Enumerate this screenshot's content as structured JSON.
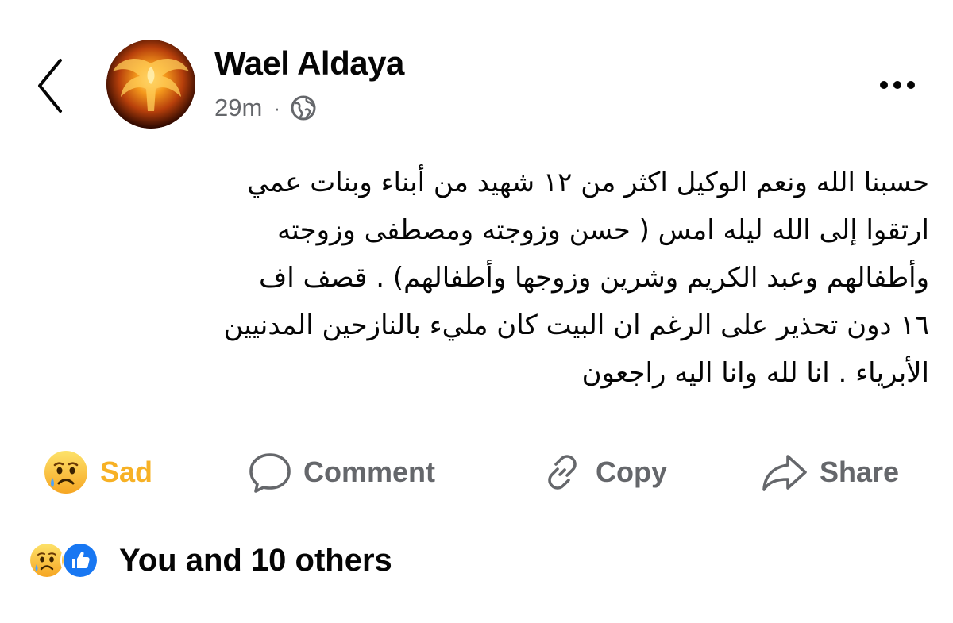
{
  "post": {
    "author": "Wael Aldaya",
    "time": "29m",
    "separator": "·",
    "privacy_icon": "globe-icon",
    "text_lines": [
      "حسبنا الله ونعم الوكيل اكثر من ١٢ شهيد من أبناء وبنات  عمي",
      "ارتقوا إلى الله  ليله امس ( حسن وزوجته ومصطفى  وزوجته",
      "وأطفالهم  وعبد الكريم وشرين وزوجها وأطفالهم) . قصف اف",
      "١٦ دون تحذير على الرغم ان البيت كان مليء بالنازحين المدنيين",
      "الأبرياء . انا لله وانا اليه راجعون"
    ]
  },
  "actions": {
    "sad_label": "Sad",
    "comment_label": "Comment",
    "copy_label": "Copy",
    "share_label": "Share"
  },
  "reactions": {
    "summary": "You and 10 others",
    "icons": [
      "sad-face-icon",
      "like-thumb-icon"
    ]
  },
  "colors": {
    "sad_accent": "#f7b125",
    "muted_text": "#65676b",
    "like_blue": "#1877f2"
  }
}
